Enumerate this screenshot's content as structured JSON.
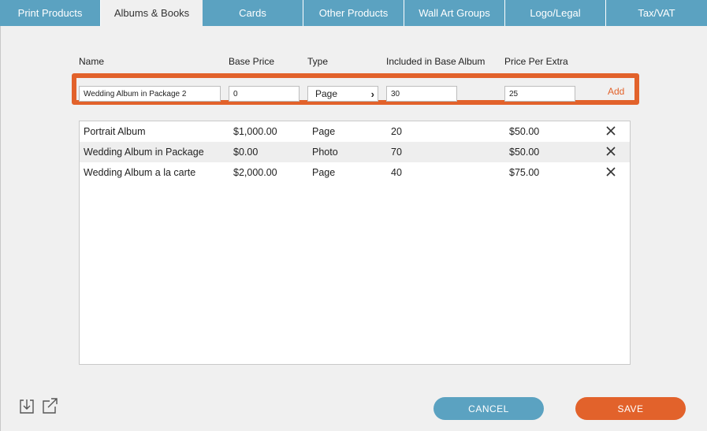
{
  "tabs": [
    {
      "label": "Print Products",
      "active": false
    },
    {
      "label": "Albums & Books",
      "active": true
    },
    {
      "label": "Cards",
      "active": false
    },
    {
      "label": "Other Products",
      "active": false
    },
    {
      "label": "Wall Art Groups",
      "active": false
    },
    {
      "label": "Logo/Legal",
      "active": false
    },
    {
      "label": "Tax/VAT",
      "active": false
    }
  ],
  "columns": {
    "name": "Name",
    "base_price": "Base Price",
    "type": "Type",
    "included": "Included in Base Album",
    "price_per_extra": "Price Per Extra"
  },
  "new_item": {
    "name": "Wedding Album in Package 2",
    "base_price": "0",
    "type": "Page",
    "included": "30",
    "price_per_extra": "25",
    "add_label": "Add"
  },
  "rows": [
    {
      "name": "Portrait Album",
      "base_price": "$1,000.00",
      "type": "Page",
      "included": "20",
      "price_per_extra": "$50.00"
    },
    {
      "name": "Wedding Album in Package",
      "base_price": "$0.00",
      "type": "Photo",
      "included": "70",
      "price_per_extra": "$50.00"
    },
    {
      "name": "Wedding Album a la carte",
      "base_price": "$2,000.00",
      "type": "Page",
      "included": "40",
      "price_per_extra": "$75.00"
    }
  ],
  "buttons": {
    "cancel": "CANCEL",
    "save": "SAVE"
  },
  "icons": {
    "import": "import-icon",
    "export": "export-icon",
    "delete": "close-icon",
    "dropdown": "chevron-right-icon"
  },
  "colors": {
    "tab_bar": "#5ba2c1",
    "accent": "#e2622b",
    "cancel_button": "#5ba2c1",
    "save_button": "#e2622b"
  }
}
